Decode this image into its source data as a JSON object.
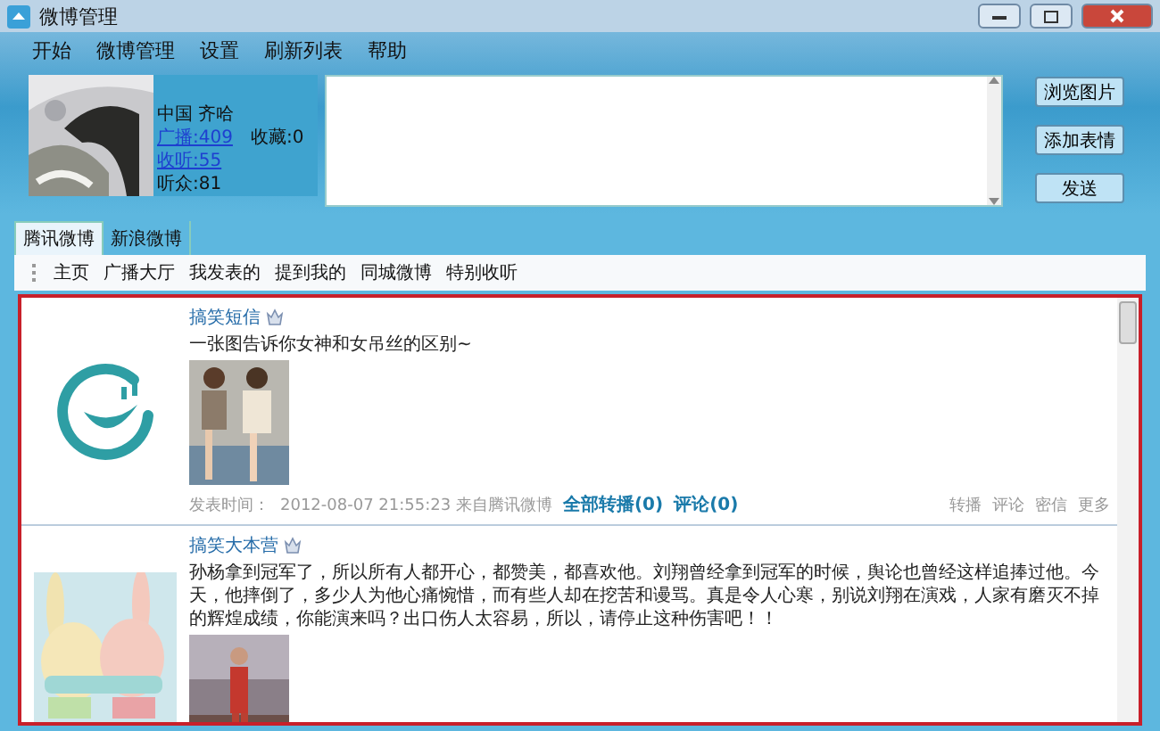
{
  "window": {
    "title": "微博管理"
  },
  "menu": [
    "开始",
    "微博管理",
    "设置",
    "刷新列表",
    "帮助"
  ],
  "profile": {
    "location": "中国 齐哈",
    "stats": [
      {
        "label": "广播:409",
        "link": true
      },
      {
        "label": "收藏:0",
        "link": false
      },
      {
        "label": "收听:55",
        "link": true
      },
      {
        "label": "听众:81",
        "link": false
      }
    ]
  },
  "compose_buttons": [
    "浏览图片",
    "添加表情",
    "发送"
  ],
  "tabs": [
    {
      "label": "腾讯微博",
      "selected": true
    },
    {
      "label": "新浪微博",
      "selected": false
    }
  ],
  "subnav": [
    "主页",
    "广播大厅",
    "我发表的",
    "提到我的",
    "同城微博",
    "特别收听"
  ],
  "posts": [
    {
      "kind": "logo",
      "author": "搞笑短信",
      "text": "一张图告诉你女神和女吊丝的区别~",
      "footer": {
        "time_label": "发表时间：",
        "time": "2012-08-07 21:55:23 来自腾讯微博",
        "links": [
          "全部转播(0)",
          "评论(0)"
        ],
        "actions": [
          "转播",
          "评论",
          "密信",
          "更多"
        ]
      }
    },
    {
      "kind": "picture",
      "author": "搞笑大本营",
      "text": "孙杨拿到冠军了，所以所有人都开心，都赞美，都喜欢他。刘翔曾经拿到冠军的时候，舆论也曾经这样追捧过他。今天，他摔倒了，多少人为他心痛惋惜，而有些人却在挖苦和谩骂。真是令人心寒，别说刘翔在演戏，人家有磨灭不掉的辉煌成绩，你能演来吗？出口伤人太容易，所以，请停止这种伤害吧！！"
    }
  ]
}
